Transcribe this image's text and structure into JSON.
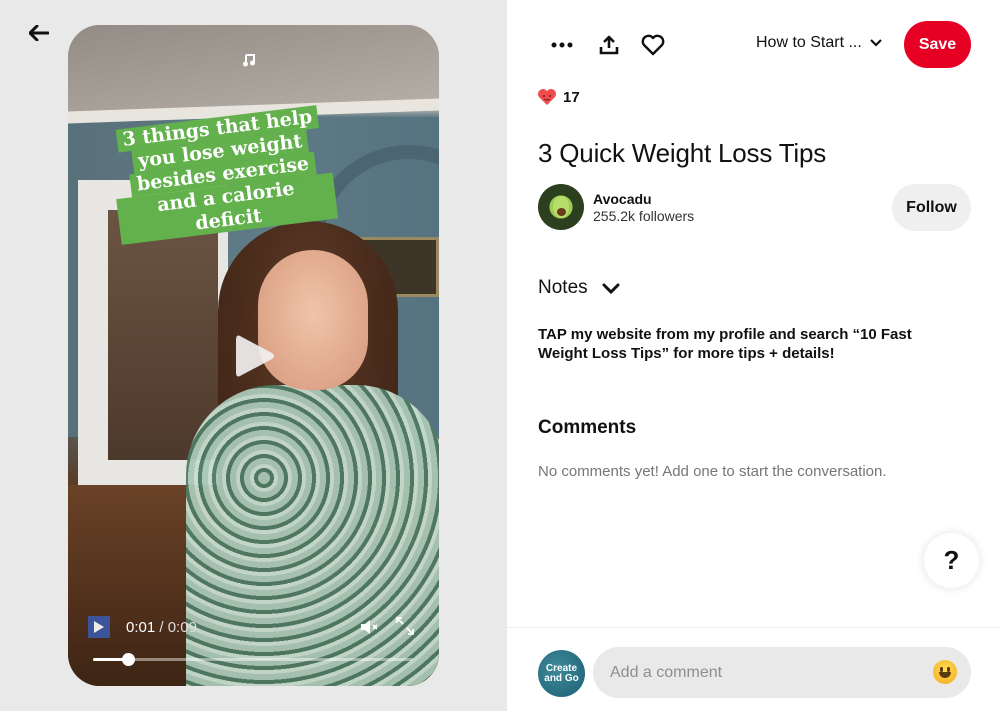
{
  "nav": {
    "back_label": "Back"
  },
  "video": {
    "caption_lines": [
      "3 things that help",
      "you lose weight",
      "besides exercise",
      "and a calorie deficit"
    ],
    "music_icon": "music-note-icon",
    "current_time": "0:01",
    "separator": " / ",
    "duration": "0:09",
    "progress_fraction": 0.11,
    "muted": true
  },
  "toolbar": {
    "more_icon": "more-options-icon",
    "share_icon": "share-icon",
    "like_icon": "heart-icon",
    "board_name": "How to Start ...",
    "save_label": "Save",
    "save_color": "#e60023"
  },
  "pin": {
    "reaction_count": "17",
    "title": "3 Quick Weight Loss Tips",
    "creator": {
      "name": "Avocadu",
      "followers": "255.2k followers"
    },
    "follow_label": "Follow"
  },
  "notes": {
    "header": "Notes",
    "body": "TAP my website from my profile and search “10 Fast Weight Loss Tips” for more tips + details!"
  },
  "comments": {
    "header": "Comments",
    "empty_text": "No comments yet! Add one to start the conversation.",
    "input_placeholder": "Add a comment",
    "user_avatar_lines": [
      "Create",
      "and Go"
    ]
  },
  "help": {
    "label": "?"
  }
}
